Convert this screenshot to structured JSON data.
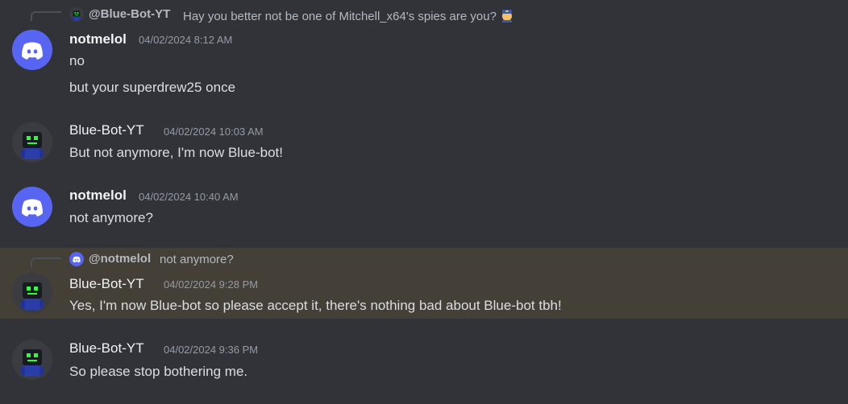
{
  "messages": [
    {
      "reply": {
        "name": "@Blue-Bot-YT",
        "text": "Hay you better not be one of Mitchell_x64's spies are you?",
        "emoji": "police-officer-icon"
      },
      "author": "notmelol",
      "avatar": "discord-logo-icon",
      "timestamp": "04/02/2024 8:12 AM",
      "lines": [
        "no",
        "but your superdrew25 once"
      ]
    },
    {
      "author": "Blue-Bot-YT",
      "avatar": "robot-avatar-icon",
      "timestamp": "04/02/2024 10:03 AM",
      "lines": [
        "But not anymore, I'm now Blue-bot!"
      ]
    },
    {
      "author": "notmelol",
      "avatar": "discord-logo-icon",
      "timestamp": "04/02/2024 10:40 AM",
      "lines": [
        "not anymore?"
      ]
    },
    {
      "reply": {
        "name": "@notmelol",
        "text": "not anymore?"
      },
      "author": "Blue-Bot-YT",
      "avatar": "robot-avatar-icon",
      "timestamp": "04/02/2024 9:28 PM",
      "lines": [
        "Yes, I'm now Blue-bot so please accept it, there's nothing bad about Blue-bot tbh!"
      ],
      "highlighted": true
    },
    {
      "author": "Blue-Bot-YT",
      "avatar": "robot-avatar-icon",
      "timestamp": "04/02/2024 9:36 PM",
      "lines": [
        "So please stop bothering me."
      ]
    }
  ],
  "colors": {
    "background": "#313338",
    "highlight": "#443f37",
    "blurple": "#5865f2",
    "muted": "#949ba4"
  }
}
